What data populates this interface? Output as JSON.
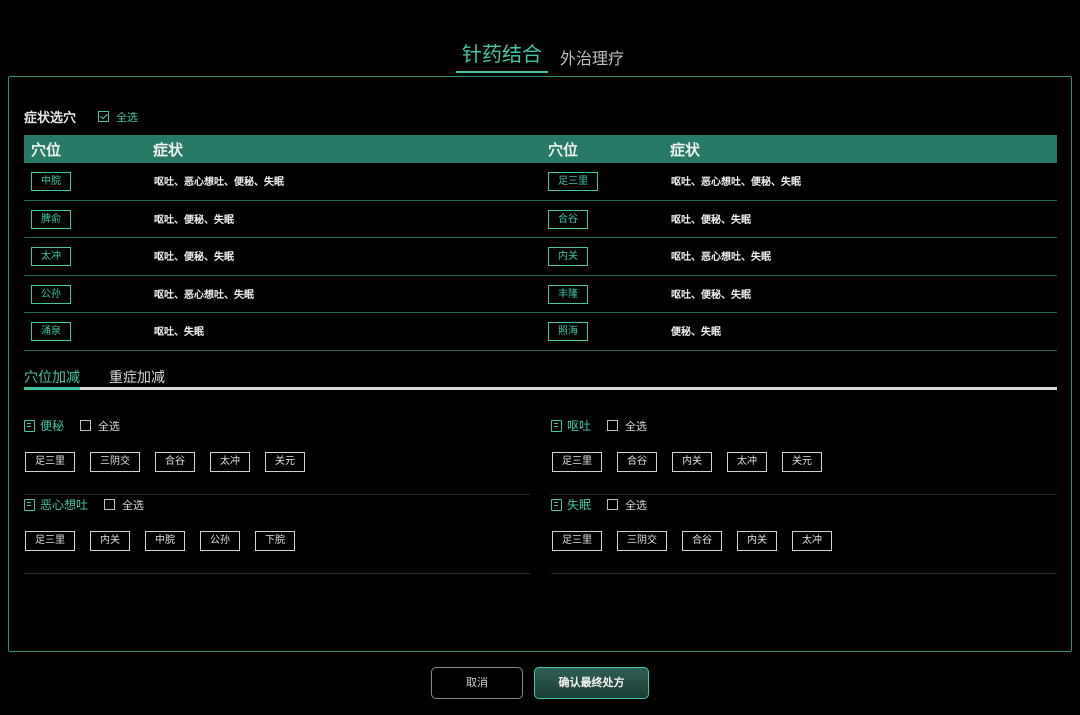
{
  "top_tabs": {
    "active": "针药结合",
    "inactive": "外治理疗"
  },
  "symptom_select": {
    "title": "症状选穴",
    "select_all": "全选",
    "select_all_checked": true
  },
  "table": {
    "headers": [
      "穴位",
      "症状",
      "穴位",
      "症状"
    ],
    "rows": [
      {
        "left_point": "中脘",
        "left_symptoms": "呕吐、恶心想吐、便秘、失眠",
        "right_point": "足三里",
        "right_symptoms": "呕吐、恶心想吐、便秘、失眠"
      },
      {
        "left_point": "脾俞",
        "left_symptoms": "呕吐、便秘、失眠",
        "right_point": "合谷",
        "right_symptoms": "呕吐、便秘、失眠"
      },
      {
        "left_point": "太冲",
        "left_symptoms": "呕吐、便秘、失眠",
        "right_point": "内关",
        "right_symptoms": "呕吐、恶心想吐、失眠"
      },
      {
        "left_point": "公孙",
        "left_symptoms": "呕吐、恶心想吐、失眠",
        "right_point": "丰隆",
        "right_symptoms": "呕吐、便秘、失眠"
      },
      {
        "left_point": "涌泉",
        "left_symptoms": "呕吐、失眠",
        "right_point": "照海",
        "right_symptoms": "便秘、失眠"
      }
    ]
  },
  "sub_tabs": {
    "active": "穴位加减",
    "inactive": "重症加减"
  },
  "groups": [
    {
      "name": "便秘",
      "select_all": "全选",
      "points": [
        "足三里",
        "三阴交",
        "合谷",
        "太冲",
        "关元"
      ]
    },
    {
      "name": "呕吐",
      "select_all": "全选",
      "points": [
        "足三里",
        "合谷",
        "内关",
        "太冲",
        "关元"
      ]
    },
    {
      "name": "恶心想吐",
      "select_all": "全选",
      "points": [
        "足三里",
        "内关",
        "中脘",
        "公孙",
        "下脘"
      ]
    },
    {
      "name": "失眠",
      "select_all": "全选",
      "points": [
        "足三里",
        "三阴交",
        "合谷",
        "内关",
        "太冲"
      ]
    }
  ],
  "buttons": {
    "cancel": "取消",
    "confirm": "确认最终处方"
  },
  "colors": {
    "accent": "#3fc7a6",
    "header_bg": "#267a66",
    "background": "#000000"
  }
}
